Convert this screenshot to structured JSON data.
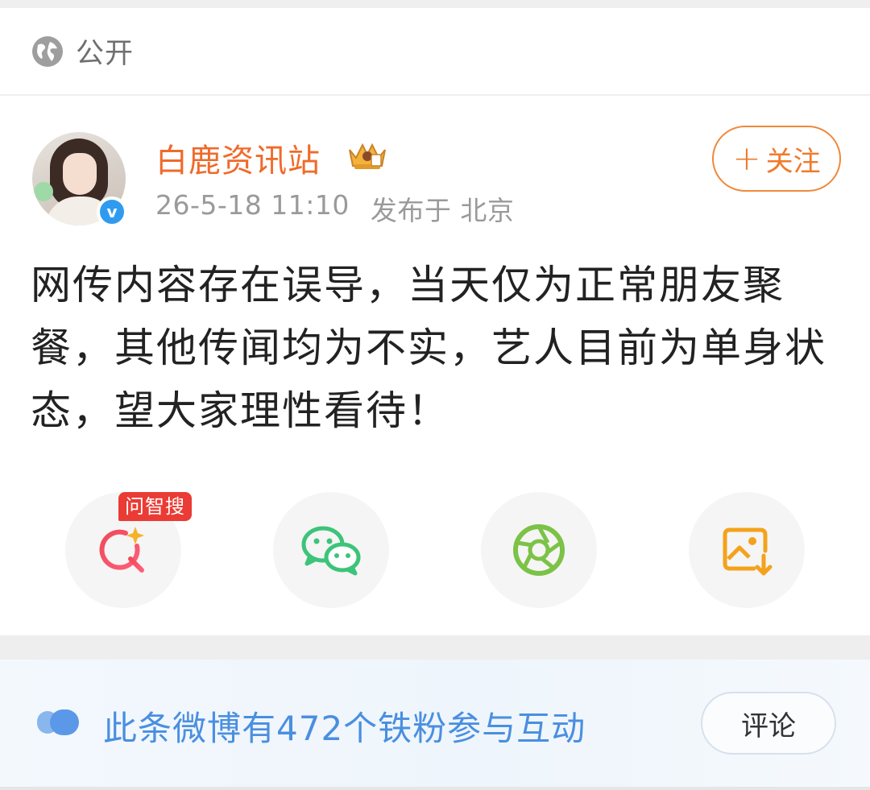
{
  "visibility": {
    "label": "公开",
    "icon": "globe-icon"
  },
  "post": {
    "author": "白鹿资讯站",
    "author_color": "#f06a2a",
    "timestamp": "26-5-18 11:10",
    "location": "发布于 北京",
    "follow_label": "+关注",
    "follow_plus": "+",
    "follow_text": "关注",
    "text": "网传内容存在误导，当天仅为正常朋友聚餐，其他传闻均为不实，艺人目前为单身状态，望大家理性看待！"
  },
  "actions": {
    "ai_search_tag": "问智搜",
    "items": [
      {
        "icon": "ai-search-icon"
      },
      {
        "icon": "wechat-icon"
      },
      {
        "icon": "moments-aperture-icon"
      },
      {
        "icon": "save-image-icon"
      }
    ]
  },
  "fan_bar": {
    "text": "此条微博有472个铁粉参与互动",
    "comment_label": "评论",
    "accent": "#4a8fe0"
  }
}
